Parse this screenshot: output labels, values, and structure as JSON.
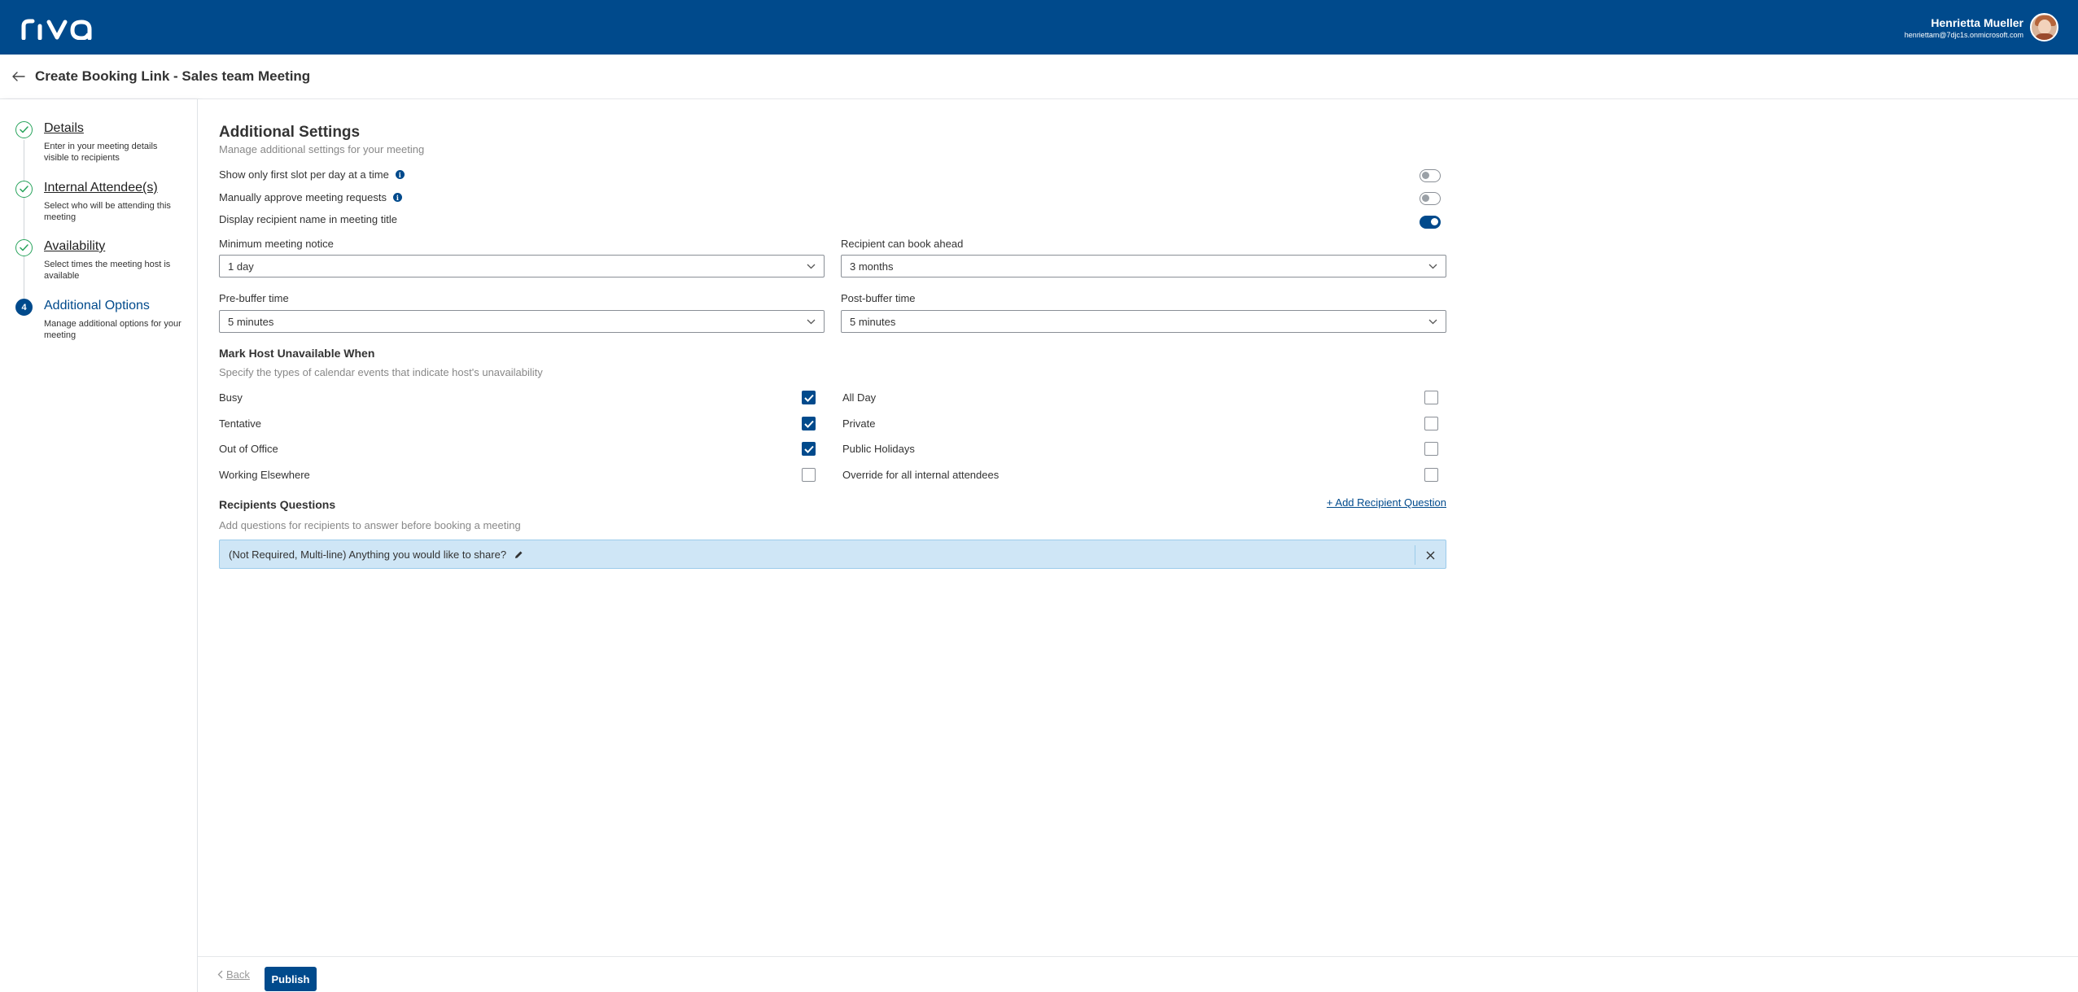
{
  "header": {
    "brand": "riva",
    "user_name": "Henrietta Mueller",
    "user_email": "henriettam@7djc1s.onmicrosoft.com"
  },
  "page": {
    "title": "Create Booking Link - Sales team Meeting"
  },
  "steps": [
    {
      "number": "1",
      "title": "Details",
      "desc": "Enter in your meeting details visible to recipients",
      "status": "complete"
    },
    {
      "number": "2",
      "title": "Internal Attendee(s)",
      "desc": "Select who will be attending this meeting",
      "status": "complete"
    },
    {
      "number": "3",
      "title": "Availability",
      "desc": "Select times the meeting host is available",
      "status": "complete"
    },
    {
      "number": "4",
      "title": "Additional Options",
      "desc": "Manage additional options for your meeting",
      "status": "active"
    }
  ],
  "settings": {
    "title": "Additional Settings",
    "subtitle": "Manage additional settings for your meeting",
    "toggles": [
      {
        "label": "Show only first slot per day at a time",
        "info": true,
        "on": false
      },
      {
        "label": "Manually approve meeting requests",
        "info": true,
        "on": false
      },
      {
        "label": "Display recipient name in meeting title",
        "info": false,
        "on": true
      }
    ],
    "fields": {
      "min_notice": {
        "label": "Minimum meeting notice",
        "value": "1 day"
      },
      "book_ahead": {
        "label": "Recipient can book ahead",
        "value": "3 months"
      },
      "pre_buffer": {
        "label": "Pre-buffer time",
        "value": "5 minutes"
      },
      "post_buffer": {
        "label": "Post-buffer time",
        "value": "5 minutes"
      }
    }
  },
  "unavailable": {
    "title": "Mark Host Unavailable When",
    "subtitle": "Specify the types of calendar events that indicate host's unavailability",
    "left": [
      {
        "label": "Busy",
        "checked": true
      },
      {
        "label": "Tentative",
        "checked": true
      },
      {
        "label": "Out of Office",
        "checked": true
      },
      {
        "label": "Working Elsewhere",
        "checked": false
      }
    ],
    "right": [
      {
        "label": "All Day",
        "checked": false
      },
      {
        "label": "Private",
        "checked": false
      },
      {
        "label": "Public Holidays",
        "checked": false
      },
      {
        "label": "Override for all internal attendees",
        "checked": false
      }
    ]
  },
  "questions": {
    "title": "Recipients Questions",
    "add_link": "+ Add Recipient Question",
    "subtitle": "Add questions for recipients to answer before booking a meeting",
    "items": [
      {
        "text": "(Not Required, Multi-line) Anything you would like to share?"
      }
    ]
  },
  "footer": {
    "back_label": "Back",
    "publish_label": "Publish"
  },
  "colors": {
    "brand": "#004a8c",
    "success": "#27a35b",
    "question_bg": "#cfe6f6"
  }
}
